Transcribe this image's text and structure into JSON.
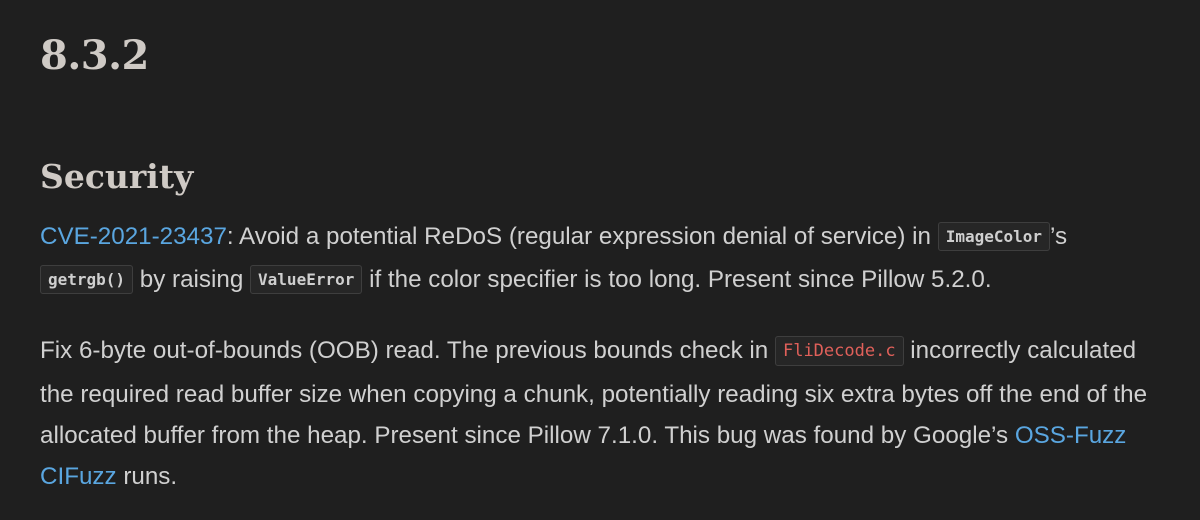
{
  "version_heading": "8.3.2",
  "section_heading": "Security",
  "paragraph1": {
    "cve_link": "CVE-2021-23437",
    "text_a": ": Avoid a potential ReDoS (regular expression denial of service) in ",
    "code_imagecolor": "ImageColor",
    "text_b": "’s",
    "code_getrgb": "getrgb()",
    "text_c": " by raising ",
    "code_valueerror": "ValueError",
    "text_d": " if the color specifier is too long. Present since Pillow 5.2.0."
  },
  "paragraph2": {
    "text_a": "Fix 6-byte out-of-bounds (OOB) read. The previous bounds check in ",
    "code_file": "FliDecode.c",
    "text_b": " incorrectly calculated the required read buffer size when copying a chunk, potentially reading six extra bytes off the end of the allocated buffer from the heap. Present since Pillow 7.1.0. This bug was found by Google’s ",
    "link_ossfuzz": "OSS-Fuzz",
    "text_space": " ",
    "link_cifuzz": "CIFuzz",
    "text_c": " runs."
  }
}
